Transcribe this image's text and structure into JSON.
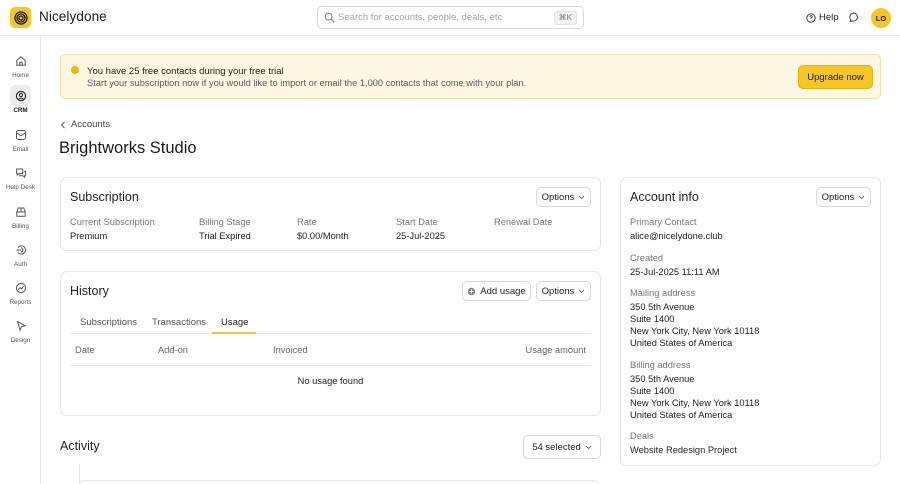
{
  "app": {
    "name": "Nicelydone",
    "avatar_initials": "LO",
    "brand_color": "#f6c624"
  },
  "search": {
    "placeholder": "Search for accounts, people, deals, etc",
    "shortcut": "⌘K"
  },
  "header": {
    "help_label": "Help"
  },
  "sidebar": {
    "items": [
      {
        "label": "Home",
        "icon": "home-icon",
        "active": false
      },
      {
        "label": "CRM",
        "icon": "crm-icon",
        "active": true
      },
      {
        "label": "Email",
        "icon": "email-icon",
        "active": false
      },
      {
        "label": "Help Desk",
        "icon": "help-desk-icon",
        "active": false
      },
      {
        "label": "Billing",
        "icon": "billing-icon",
        "active": false
      },
      {
        "label": "Auth",
        "icon": "auth-icon",
        "active": false
      },
      {
        "label": "Reports",
        "icon": "reports-icon",
        "active": false
      },
      {
        "label": "Design",
        "icon": "design-icon",
        "active": false
      }
    ]
  },
  "banner": {
    "title": "You have 25 free contacts during your free trial",
    "subtitle": "Start your subscription now if you would like to import or email the 1,000 contacts that come with your plan.",
    "cta": "Upgrade now"
  },
  "breadcrumb": {
    "label": "Accounts"
  },
  "page": {
    "title": "Brightworks Studio"
  },
  "subscription": {
    "title": "Subscription",
    "options_label": "Options",
    "fields": [
      {
        "label": "Current Subscription",
        "value": "Premium"
      },
      {
        "label": "Billing Stage",
        "value": "Trial Expired"
      },
      {
        "label": "Rate",
        "value": "$0.00/Month"
      },
      {
        "label": "Start Date",
        "value": "25-Jul-2025"
      },
      {
        "label": "Renewal Date",
        "value": ""
      }
    ]
  },
  "history": {
    "title": "History",
    "add_usage_label": "Add usage",
    "options_label": "Options",
    "tabs": [
      {
        "label": "Subscriptions",
        "active": false
      },
      {
        "label": "Transactions",
        "active": false
      },
      {
        "label": "Usage",
        "active": true
      }
    ],
    "columns": [
      "Date",
      "Add-on",
      "Invoiced",
      "Usage amount"
    ],
    "empty_text": "No usage found"
  },
  "account_info": {
    "title": "Account info",
    "options_label": "Options",
    "primary_contact": {
      "label": "Primary Contact",
      "value": "alice@nicelydone.club"
    },
    "created": {
      "label": "Created",
      "value": "25-Jul-2025 11:11 AM"
    },
    "mailing": {
      "label": "Mailing address",
      "lines": [
        "350 5th Avenue",
        "Suite 1400",
        "New York City, New York  10118",
        "United States of America"
      ]
    },
    "billing": {
      "label": "Billing address",
      "lines": [
        "350 5th Avenue",
        "Suite 1400",
        "New York City, New York  10118",
        "United States of America"
      ]
    },
    "deals": {
      "label": "Deals",
      "value": "Website Redesign Project"
    }
  },
  "activity": {
    "title": "Activity",
    "filter_label": "54 selected"
  }
}
